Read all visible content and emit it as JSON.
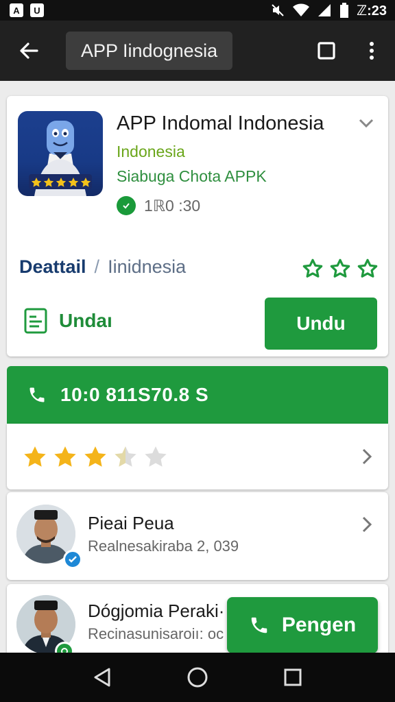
{
  "status_bar": {
    "left_icons": [
      "image-notification-icon",
      "storage-notification-icon"
    ],
    "left_glyphs": [
      "A",
      "U"
    ],
    "right_icons": [
      "mute-icon",
      "wifi-icon",
      "signal-icon",
      "battery-icon"
    ],
    "time": "ℤ:23"
  },
  "app_bar": {
    "title": "APP Iindognesia",
    "back_icon": "arrow-left-icon",
    "window_icon": "square-icon",
    "more_icon": "more-vert-icon"
  },
  "app_card": {
    "name": "APP Indomal Indonesia",
    "country": "Indonesia",
    "developer": "Siabuga Chota APPK",
    "meta": "1ℝ0 :30",
    "breadcrumb": {
      "primary": "Deattail",
      "separator": "/",
      "secondary": "Iinidnesia"
    },
    "star_count": 3,
    "link_label": "Undaı",
    "button_label": "Undu"
  },
  "phone": {
    "number": "10:0 811S70.8 S"
  },
  "rating": {
    "value": 3.5,
    "max": 5
  },
  "people": [
    {
      "name": "Pieai Peua",
      "subtitle": "Realnesakiraba 2, 039",
      "badge": "verified-icon"
    },
    {
      "name": "Dógjomia Peraki·",
      "subtitle": "Recinasunisaroiı: oc",
      "badge": "whatsapp-icon"
    }
  ],
  "fab": {
    "label": "Pengen",
    "icon": "phone-icon"
  },
  "nav": [
    "back-triangle-icon",
    "home-circle-icon",
    "recents-square-icon"
  ],
  "colors": {
    "primary_green": "#1f9a3e",
    "app_bar": "#212121",
    "status_bar": "#111111",
    "breadcrumb_blue": "#173b6e",
    "star_gold": "#f4b41a"
  }
}
